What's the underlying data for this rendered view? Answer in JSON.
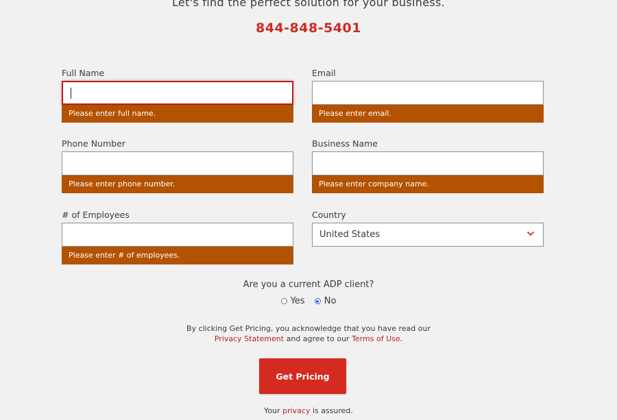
{
  "header": {
    "headline": "Let's find the perfect solution for your business.",
    "phone": "844-848-5401"
  },
  "form": {
    "full_name": {
      "label": "Full Name",
      "value": "",
      "error": "Please enter full name."
    },
    "email": {
      "label": "Email",
      "value": "",
      "error": "Please enter email."
    },
    "phone_number": {
      "label": "Phone Number",
      "value": "",
      "error": "Please enter phone number."
    },
    "business_name": {
      "label": "Business Name",
      "value": "",
      "error": "Please enter company name."
    },
    "employees": {
      "label": "# of Employees",
      "value": "",
      "error": "Please enter # of employees."
    },
    "country": {
      "label": "Country",
      "value": "United States"
    }
  },
  "client_question": {
    "text": "Are you a current ADP client?",
    "yes_label": "Yes",
    "no_label": "No",
    "selected": "No"
  },
  "legal": {
    "line1": "By clicking Get Pricing, you acknowledge that you have read our",
    "privacy_link": "Privacy Statement",
    "middle": "and agree to our",
    "terms_link": "Terms of Use",
    "end": "."
  },
  "submit_label": "Get Pricing",
  "assured": {
    "prefix": "Your",
    "link": "privacy",
    "suffix": "is assured."
  },
  "colors": {
    "accent": "#d42a20",
    "error_bar": "#b35200",
    "link": "#b0261c",
    "radio": "#2a6fd6"
  }
}
